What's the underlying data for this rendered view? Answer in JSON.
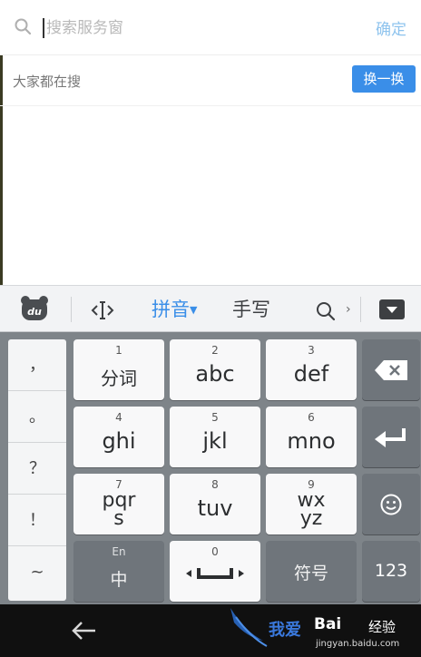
{
  "search": {
    "placeholder": "搜索服务窗",
    "confirm_label": "确定"
  },
  "hot": {
    "title": "大家都在搜",
    "refresh_label": "换一换"
  },
  "keyboard": {
    "toolbar": {
      "pinyin_label": "拼音",
      "handwriting_label": "手写"
    },
    "side_symbols": [
      "，",
      "。",
      "？",
      "！",
      "~"
    ],
    "keys": [
      {
        "num": "1",
        "label": "分词"
      },
      {
        "num": "2",
        "label": "abc"
      },
      {
        "num": "3",
        "label": "def"
      },
      {
        "num": "4",
        "label": "ghi"
      },
      {
        "num": "5",
        "label": "jkl"
      },
      {
        "num": "6",
        "label": "mno"
      },
      {
        "num": "7",
        "label": "pqrs"
      },
      {
        "num": "8",
        "label": "tuv"
      },
      {
        "num": "9",
        "label": "wxyz"
      }
    ],
    "lang_top": "En",
    "lang_main": "中",
    "space_num": "0",
    "symbol_label": "符号",
    "num_label": "123"
  },
  "watermark": {
    "text1": "我爱",
    "text2": "Bai",
    "text3": "经验",
    "url": "jingyan.baidu.com"
  },
  "colors": {
    "accent": "#3a8ee8",
    "confirm": "#8fc4ee",
    "keyboard_bg": "#7e8489",
    "nav_bg": "#101010"
  },
  "icons": [
    "search-icon",
    "du-logo-icon",
    "cursor-move-icon",
    "keyboard-search-icon",
    "collapse-keyboard-icon",
    "backspace-icon",
    "enter-icon",
    "emoji-icon",
    "back-arrow-icon"
  ]
}
